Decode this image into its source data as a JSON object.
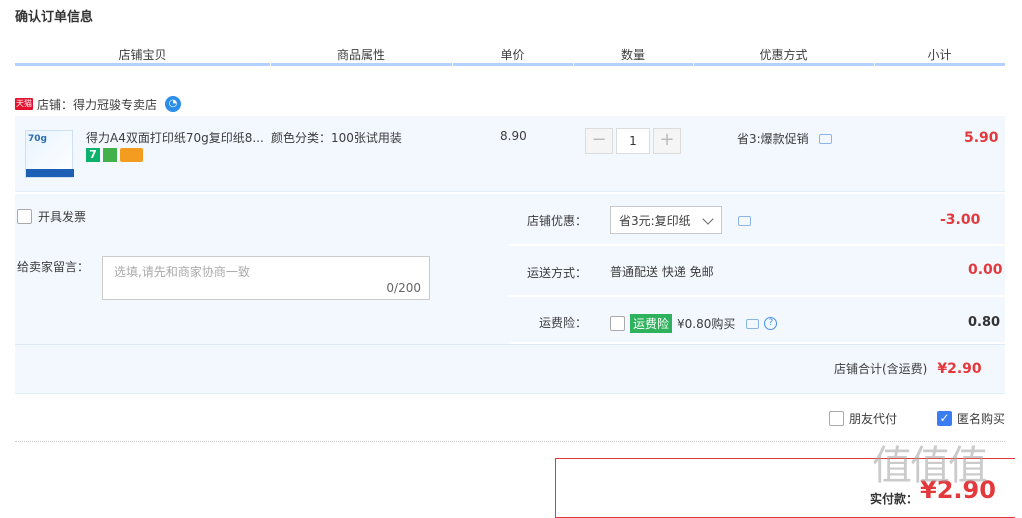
{
  "page_title": "确认订单信息",
  "columns": [
    "店铺宝贝",
    "商品属性",
    "单价",
    "数量",
    "优惠方式",
    "小计"
  ],
  "shop": {
    "badge": "天猫",
    "label": "店铺：得力冠骏专卖店"
  },
  "item": {
    "thumb_text": "70g",
    "name": "得力A4双面打印纸70g复印纸8...",
    "attribute": "颜色分类：100张试用装",
    "price": "8.90",
    "quantity": "1",
    "minus": "−",
    "plus": "+",
    "promo": "省3:爆款促销",
    "subtotal": "5.90",
    "badge_7": "7"
  },
  "invoice": {
    "label": "开具发票"
  },
  "message": {
    "label": "给卖家留言：",
    "placeholder": "选填,请先和商家协商一致",
    "counter": "0/200"
  },
  "shop_discount": {
    "label": "店铺优惠：",
    "value": "省3元:复印纸",
    "amount": "-3.00"
  },
  "shipping": {
    "label": "运送方式：",
    "value": "普通配送 快递 免邮",
    "amount": "0.00"
  },
  "insurance": {
    "label": "运费险：",
    "badge": "运费险",
    "price": "¥0.80购买",
    "help": "?",
    "amount": "0.80"
  },
  "shop_total": {
    "label": "店铺合计(含运费)",
    "value": "¥2.90"
  },
  "friend_pay": {
    "label": "朋友代付"
  },
  "anonymous": {
    "label": "匿名购买",
    "checked": "✓"
  },
  "payment": {
    "label": "实付款：",
    "value": "¥2.90"
  },
  "watermark": "值值值"
}
